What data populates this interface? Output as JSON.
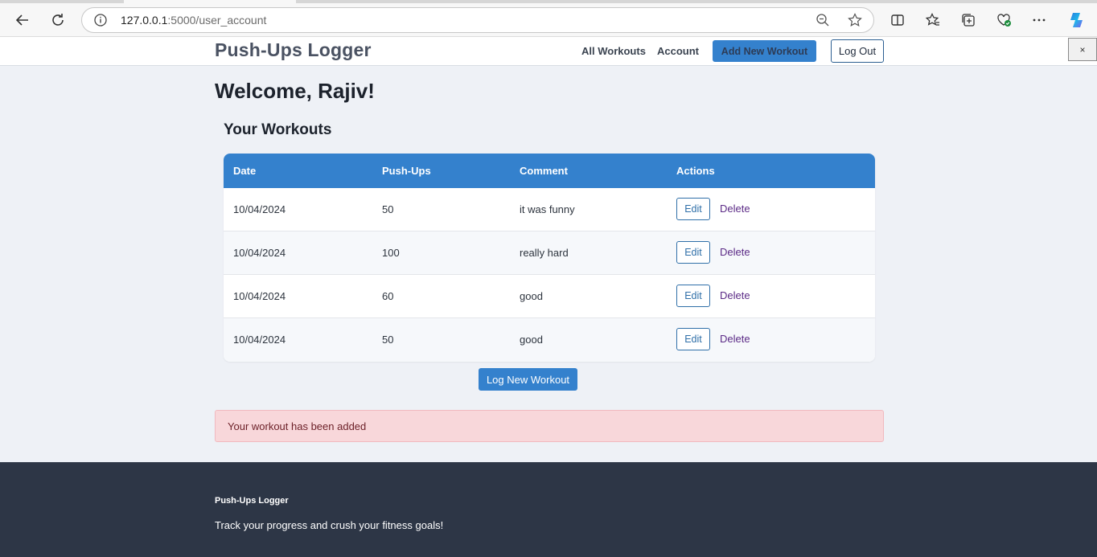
{
  "browser": {
    "url_host": "127.0.0.1",
    "url_path": ":5000/user_account"
  },
  "header": {
    "brand": "Push-Ups Logger",
    "nav": {
      "all_workouts": "All Workouts",
      "account": "Account",
      "add_new_workout": "Add New Workout",
      "log_out": "Log Out"
    },
    "close_label": "×"
  },
  "main": {
    "welcome": "Welcome, Rajiv!",
    "section_title": "Your Workouts",
    "table": {
      "headers": [
        "Date",
        "Push-Ups",
        "Comment",
        "Actions"
      ],
      "rows": [
        {
          "date": "10/04/2024",
          "pushups": "50",
          "comment": "it was funny",
          "edit": "Edit",
          "delete": "Delete"
        },
        {
          "date": "10/04/2024",
          "pushups": "100",
          "comment": "really hard",
          "edit": "Edit",
          "delete": "Delete"
        },
        {
          "date": "10/04/2024",
          "pushups": "60",
          "comment": "good",
          "edit": "Edit",
          "delete": "Delete"
        },
        {
          "date": "10/04/2024",
          "pushups": "50",
          "comment": "good",
          "edit": "Edit",
          "delete": "Delete"
        }
      ]
    },
    "log_button": "Log New Workout",
    "alert": "Your workout has been added"
  },
  "footer": {
    "title": "Push-Ups Logger",
    "tagline": "Track your progress and crush your fitness goals!"
  },
  "colors": {
    "primary": "#3481cd",
    "footer_bg": "#2d3646",
    "alert_bg": "#f8d7da",
    "page_bg": "#eef1f6"
  },
  "icons": {
    "back": "back-arrow-icon",
    "refresh": "refresh-icon",
    "info": "info-icon",
    "zoom": "zoom-out-icon",
    "favorite": "star-icon",
    "split": "split-screen-icon",
    "favorites": "favorites-icon",
    "collections": "collections-icon",
    "health": "browser-essentials-icon",
    "more": "more-icon",
    "copilot": "copilot-icon"
  }
}
